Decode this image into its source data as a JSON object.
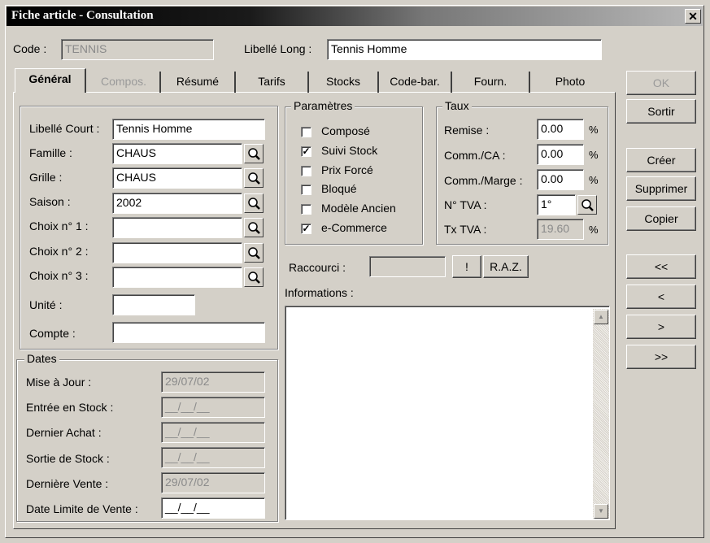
{
  "window": {
    "title": "Fiche article - Consultation",
    "close_glyph": "✕"
  },
  "header": {
    "code_label": "Code :",
    "code_value": "TENNIS",
    "libelle_long_label": "Libellé Long :",
    "libelle_long_value": "Tennis Homme"
  },
  "tabs": [
    {
      "label": "Général",
      "active": true
    },
    {
      "label": "Compos.",
      "disabled": true
    },
    {
      "label": "Résumé"
    },
    {
      "label": "Tarifs"
    },
    {
      "label": "Stocks"
    },
    {
      "label": "Code-bar."
    },
    {
      "label": "Fourn."
    },
    {
      "label": "Photo"
    }
  ],
  "general": {
    "libelle_court_label": "Libellé Court :",
    "libelle_court_value": "Tennis Homme",
    "famille_label": "Famille :",
    "famille_value": "CHAUS",
    "grille_label": "Grille :",
    "grille_value": "CHAUS",
    "saison_label": "Saison :",
    "saison_value": "2002",
    "choix1_label": "Choix n° 1 :",
    "choix1_value": "",
    "choix2_label": "Choix n° 2 :",
    "choix2_value": "",
    "choix3_label": "Choix n° 3 :",
    "choix3_value": "",
    "unite_label": "Unité :",
    "unite_value": "",
    "compte_label": "Compte :",
    "compte_value": ""
  },
  "dates": {
    "legend": "Dates",
    "mise_a_jour_label": "Mise à Jour :",
    "mise_a_jour_value": "29/07/02",
    "entree_stock_label": "Entrée en Stock :",
    "entree_stock_value": "__/__/__",
    "dernier_achat_label": "Dernier Achat :",
    "dernier_achat_value": "__/__/__",
    "sortie_stock_label": "Sortie de Stock :",
    "sortie_stock_value": "__/__/__",
    "derniere_vente_label": "Dernière Vente :",
    "derniere_vente_value": "29/07/02",
    "date_limite_label": "Date Limite de Vente :",
    "date_limite_value": "__/__/__"
  },
  "parametres": {
    "legend": "Paramètres",
    "items": [
      {
        "label": "Composé",
        "checked": false
      },
      {
        "label": "Suivi Stock",
        "checked": true
      },
      {
        "label": "Prix Forcé",
        "checked": false
      },
      {
        "label": "Bloqué",
        "checked": false
      },
      {
        "label": "Modèle Ancien",
        "checked": false
      },
      {
        "label": "e-Commerce",
        "checked": true
      }
    ]
  },
  "taux": {
    "legend": "Taux",
    "remise_label": "Remise :",
    "remise_value": "0.00",
    "comm_ca_label": "Comm./CA :",
    "comm_ca_value": "0.00",
    "comm_marge_label": "Comm./Marge :",
    "comm_marge_value": "0.00",
    "tva_label": "N° TVA :",
    "tva_value": "1°",
    "tx_tva_label": "Tx TVA :",
    "tx_tva_value": "19.60",
    "percent": "%"
  },
  "raccourci": {
    "label": "Raccourci :",
    "value": "",
    "bang": "!",
    "raz": "R.A.Z."
  },
  "informations": {
    "label": "Informations :",
    "value": ""
  },
  "side_buttons": {
    "ok": "OK",
    "sortir": "Sortir",
    "creer": "Créer",
    "supprimer": "Supprimer",
    "copier": "Copier",
    "first": "<<",
    "prev": "<",
    "next": ">",
    "last": ">>"
  }
}
